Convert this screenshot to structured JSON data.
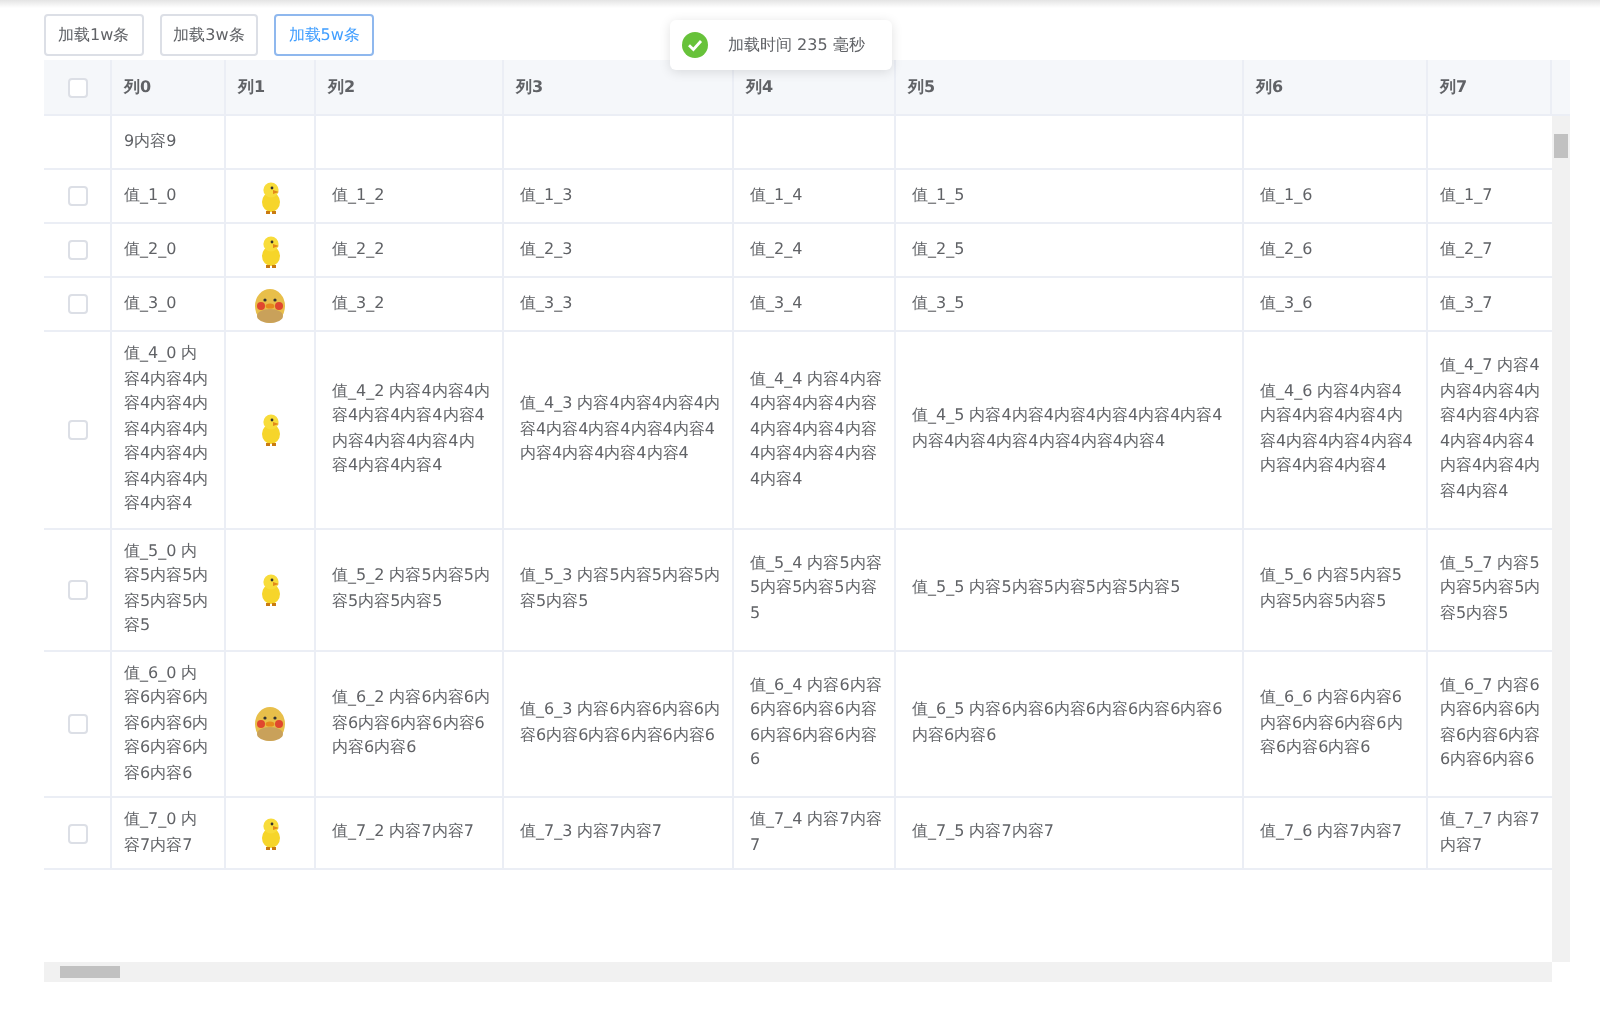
{
  "buttons": [
    {
      "label": "加载1w条",
      "selected": false
    },
    {
      "label": "加载3w条",
      "selected": false
    },
    {
      "label": "加载5w条",
      "selected": true
    }
  ],
  "toast": {
    "kind": "success",
    "message": "加载时间 235 毫秒"
  },
  "table": {
    "header_checkbox": {
      "checked": false
    },
    "columns": [
      "列0",
      "列1",
      "列2",
      "列3",
      "列4",
      "列5",
      "列6",
      "列7"
    ],
    "rows": [
      {
        "cells": [
          "9内容9",
          "",
          "",
          "",
          "",
          "",
          "",
          ""
        ]
      },
      {
        "checked": false,
        "avatar": {
          "kind": "chick"
        },
        "cells": [
          "值_1_0",
          "",
          "值_1_2",
          "值_1_3",
          "值_1_4",
          "值_1_5",
          "值_1_6",
          "值_1_7"
        ]
      },
      {
        "checked": false,
        "avatar": {
          "kind": "chick"
        },
        "cells": [
          "值_2_0",
          "",
          "值_2_2",
          "值_2_3",
          "值_2_4",
          "值_2_5",
          "值_2_6",
          "值_2_7"
        ]
      },
      {
        "checked": false,
        "avatar": {
          "kind": "duck"
        },
        "cells": [
          "值_3_0",
          "",
          "值_3_2",
          "值_3_3",
          "值_3_4",
          "值_3_5",
          "值_3_6",
          "值_3_7"
        ]
      },
      {
        "checked": false,
        "avatar": {
          "kind": "chick"
        },
        "cells": [
          "值_4_0 内容4内容4内容4内容4内容4内容4内容4内容4内容4内容4内容4内容4",
          "",
          "值_4_2 内容4内容4内容4内容4内容4内容4内容4内容4内容4内容4内容4内容4",
          "值_4_3 内容4内容4内容4内容4内容4内容4内容4内容4内容4内容4内容4内容4",
          "值_4_4 内容4内容4内容4内容4内容4内容4内容4内容4内容4内容4内容4内容4",
          "值_4_5 内容4内容4内容4内容4内容4内容4内容4内容4内容4内容4内容4内容4",
          "值_4_6 内容4内容4内容4内容4内容4内容4内容4内容4内容4内容4内容4内容4",
          "值_4_7 内容4内容4内容4内容4内容4内容4内容4内容4内容4内容4内容4内容4"
        ]
      },
      {
        "checked": false,
        "avatar": {
          "kind": "chick"
        },
        "cells": [
          "值_5_0 内容5内容5内容5内容5内容5",
          "",
          "值_5_2 内容5内容5内容5内容5内容5",
          "值_5_3 内容5内容5内容5内容5内容5",
          "值_5_4 内容5内容5内容5内容5内容5",
          "值_5_5 内容5内容5内容5内容5内容5",
          "值_5_6 内容5内容5内容5内容5内容5",
          "值_5_7 内容5内容5内容5内容5内容5"
        ]
      },
      {
        "checked": false,
        "avatar": {
          "kind": "duck"
        },
        "cells": [
          "值_6_0 内容6内容6内容6内容6内容6内容6内容6内容6",
          "",
          "值_6_2 内容6内容6内容6内容6内容6内容6内容6内容6",
          "值_6_3 内容6内容6内容6内容6内容6内容6内容6内容6",
          "值_6_4 内容6内容6内容6内容6内容6内容6内容6内容6",
          "值_6_5 内容6内容6内容6内容6内容6内容6内容6内容6",
          "值_6_6 内容6内容6内容6内容6内容6内容6内容6内容6",
          "值_6_7 内容6内容6内容6内容6内容6内容6内容6内容6"
        ]
      },
      {
        "checked": false,
        "avatar": {
          "kind": "chick"
        },
        "cells": [
          "值_7_0 内容7内容7",
          "",
          "值_7_2 内容7内容7",
          "值_7_3 内容7内容7",
          "值_7_4 内容7内容7",
          "值_7_5 内容7内容7",
          "值_7_6 内容7内容7",
          "值_7_7 内容7内容7"
        ]
      }
    ]
  }
}
